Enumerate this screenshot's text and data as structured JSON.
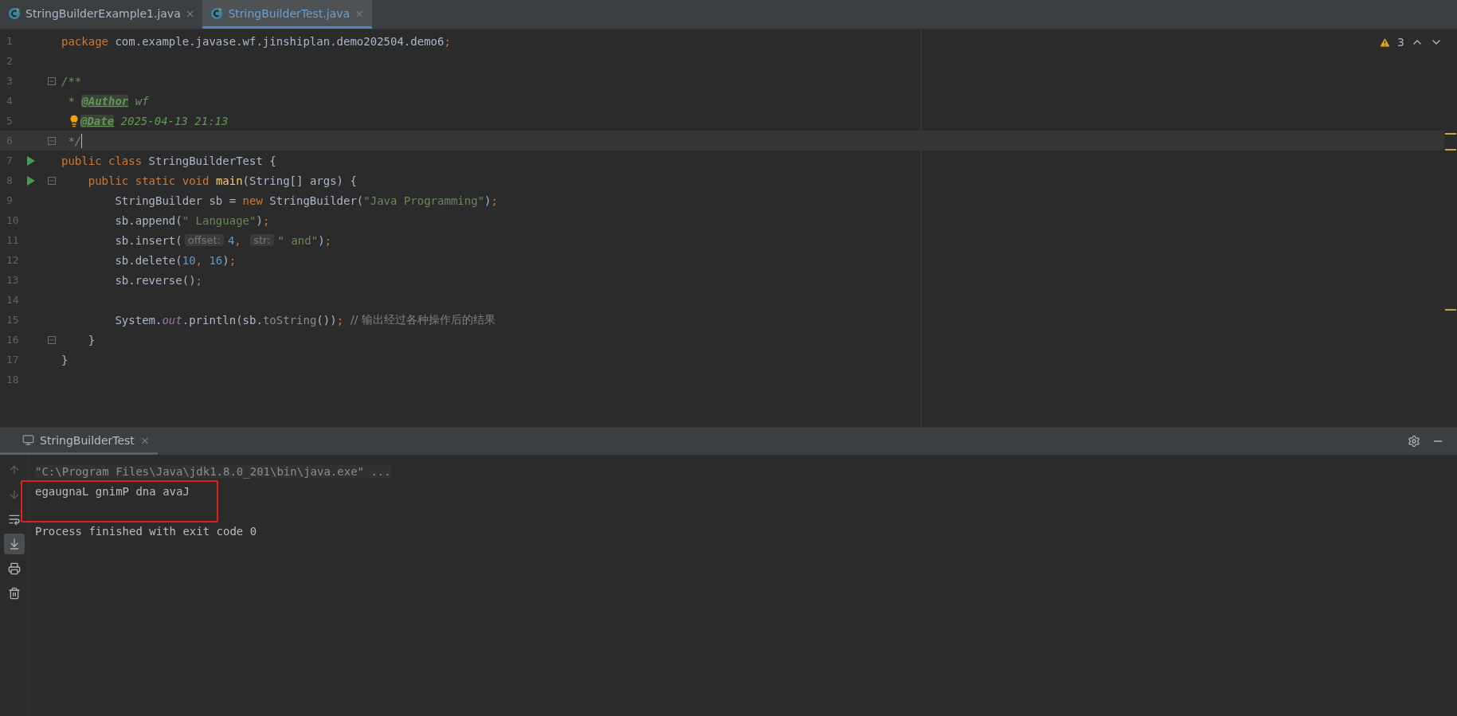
{
  "tabs": [
    {
      "label": "StringBuilderExample1.java",
      "close": "×",
      "selected": false
    },
    {
      "label": "StringBuilderTest.java",
      "close": "×",
      "selected": true
    }
  ],
  "inspections": {
    "count": "3"
  },
  "editor": {
    "lines": [
      {
        "number": "1",
        "tokens": [
          {
            "kind": "keyword",
            "text": "package "
          },
          {
            "kind": "plain",
            "text": "com.example.javase.wf.jinshiplan.demo202504.demo6"
          },
          {
            "kind": "keyword",
            "text": ";"
          }
        ]
      },
      {
        "number": "2"
      },
      {
        "number": "3",
        "markers": [
          {
            "kind": "fold"
          }
        ],
        "tokens": [
          {
            "kind": "doc",
            "text": "/**"
          }
        ]
      },
      {
        "number": "4",
        "tokens": [
          {
            "kind": "doc",
            "text": " * "
          },
          {
            "kind": "doctag",
            "text": "@Author"
          },
          {
            "kind": "docvalue",
            "text": " wf"
          }
        ]
      },
      {
        "number": "5",
        "tokens": [
          {
            "kind": "bulb"
          },
          {
            "kind": "doctag",
            "text": "@Date"
          },
          {
            "kind": "docvalue",
            "text": " 2025-04-13 21:13"
          }
        ]
      },
      {
        "number": "6",
        "current": true,
        "markers": [
          {
            "kind": "fold"
          }
        ],
        "tokens": [
          {
            "kind": "doc",
            "text": " */"
          },
          {
            "kind": "caret"
          }
        ]
      },
      {
        "number": "7",
        "markers": [
          {
            "kind": "run"
          }
        ],
        "tokens": [
          {
            "kind": "keyword",
            "text": "public class "
          },
          {
            "kind": "plain",
            "text": "StringBuilderTest {"
          }
        ]
      },
      {
        "number": "8",
        "markers": [
          {
            "kind": "run"
          },
          {
            "kind": "fold"
          }
        ],
        "tokens": [
          {
            "kind": "keyword",
            "text": "    public static void "
          },
          {
            "kind": "method",
            "text": "main"
          },
          {
            "kind": "plain",
            "text": "(String[] args) {"
          }
        ]
      },
      {
        "number": "9",
        "tokens": [
          {
            "kind": "plain",
            "text": "        StringBuilder sb = "
          },
          {
            "kind": "keyword",
            "text": "new "
          },
          {
            "kind": "plain",
            "text": "StringBuilder("
          },
          {
            "kind": "string",
            "text": "\"Java Programming\""
          },
          {
            "kind": "plain",
            "text": ")"
          },
          {
            "kind": "keyword",
            "text": ";"
          }
        ]
      },
      {
        "number": "10",
        "tokens": [
          {
            "kind": "plain",
            "text": "        sb.append("
          },
          {
            "kind": "string",
            "text": "\" Language\""
          },
          {
            "kind": "plain",
            "text": ")"
          },
          {
            "kind": "keyword",
            "text": ";"
          }
        ]
      },
      {
        "number": "11",
        "tokens": [
          {
            "kind": "plain",
            "text": "        sb.insert("
          },
          {
            "kind": "hint",
            "text": "offset:"
          },
          {
            "kind": "number",
            "text": "4"
          },
          {
            "kind": "keyword",
            "text": ", "
          },
          {
            "kind": "hint",
            "text": "str:"
          },
          {
            "kind": "string",
            "text": "\" and\""
          },
          {
            "kind": "plain",
            "text": ")"
          },
          {
            "kind": "keyword",
            "text": ";"
          }
        ]
      },
      {
        "number": "12",
        "tokens": [
          {
            "kind": "plain",
            "text": "        sb.delete("
          },
          {
            "kind": "number",
            "text": "10"
          },
          {
            "kind": "keyword",
            "text": ", "
          },
          {
            "kind": "number",
            "text": "16"
          },
          {
            "kind": "plain",
            "text": ")"
          },
          {
            "kind": "keyword",
            "text": ";"
          }
        ]
      },
      {
        "number": "13",
        "tokens": [
          {
            "kind": "plain",
            "text": "        sb.reverse()"
          },
          {
            "kind": "keyword",
            "text": ";"
          }
        ]
      },
      {
        "number": "14"
      },
      {
        "number": "15",
        "tokens": [
          {
            "kind": "plain",
            "text": "        System."
          },
          {
            "kind": "field",
            "text": "out"
          },
          {
            "kind": "plain",
            "text": ".println(sb."
          },
          {
            "kind": "dim",
            "text": "toString"
          },
          {
            "kind": "plain",
            "text": "())"
          },
          {
            "kind": "keyword",
            "text": ";"
          },
          {
            "kind": "comment",
            "text": "  // 输出经过各种操作后的结果"
          }
        ]
      },
      {
        "number": "16",
        "markers": [
          {
            "kind": "fold"
          }
        ],
        "tokens": [
          {
            "kind": "plain",
            "text": "    }"
          }
        ]
      },
      {
        "number": "17",
        "tokens": [
          {
            "kind": "plain",
            "text": "}"
          }
        ]
      },
      {
        "number": "18"
      }
    ]
  },
  "run_panel": {
    "tab": {
      "label": "StringBuilderTest",
      "close": "×"
    },
    "tools": [
      {
        "kind": "up",
        "selected": false
      },
      {
        "kind": "down",
        "selected": false
      },
      {
        "kind": "wrap",
        "selected": false
      },
      {
        "kind": "scroll-end",
        "selected": true
      },
      {
        "kind": "print",
        "selected": false
      },
      {
        "kind": "trash",
        "selected": false
      }
    ],
    "lines": [
      {
        "kind": "command",
        "text": "\"C:\\Program Files\\Java\\jdk1.8.0_201\\bin\\java.exe\" ...",
        "highlighted": false
      },
      {
        "kind": "output",
        "text": "egaugnaL gnimP dna avaJ",
        "highlighted": true
      },
      {
        "kind": "blank",
        "highlighted": false
      },
      {
        "kind": "output",
        "text": "Process finished with exit code 0",
        "highlighted": false
      }
    ]
  }
}
